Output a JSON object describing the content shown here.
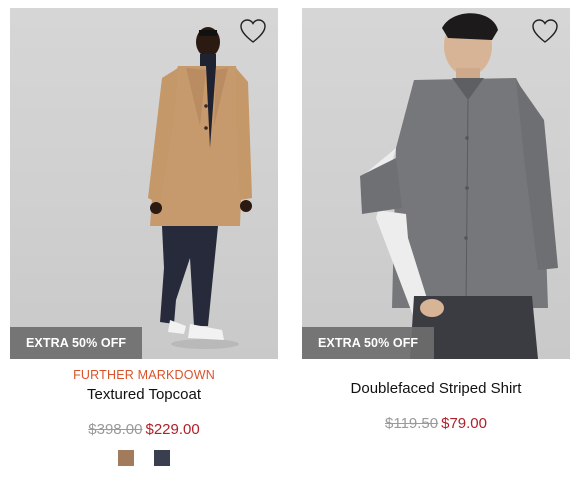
{
  "products": [
    {
      "promo": "EXTRA 50% OFF",
      "flag": "FURTHER MARKDOWN",
      "name": "Textured Topcoat",
      "was_price": "$398.00",
      "now_price": "$229.00",
      "swatches": [
        {
          "color": "#a27a5c",
          "icon": "swatch-camel"
        },
        {
          "color": "#3a3f4f",
          "icon": "swatch-navy"
        }
      ]
    },
    {
      "promo": "EXTRA 50% OFF",
      "flag": "",
      "name": "Doublefaced Striped Shirt",
      "was_price": "$119.50",
      "now_price": "$79.00",
      "swatches": []
    }
  ],
  "colors": {
    "markdown": "#d9532b",
    "sale_price": "#b0202a",
    "was_price": "#9a9a9a",
    "promo_bg": "#6e6e6e"
  },
  "icons": {
    "wishlist": "heart-outline-icon"
  }
}
